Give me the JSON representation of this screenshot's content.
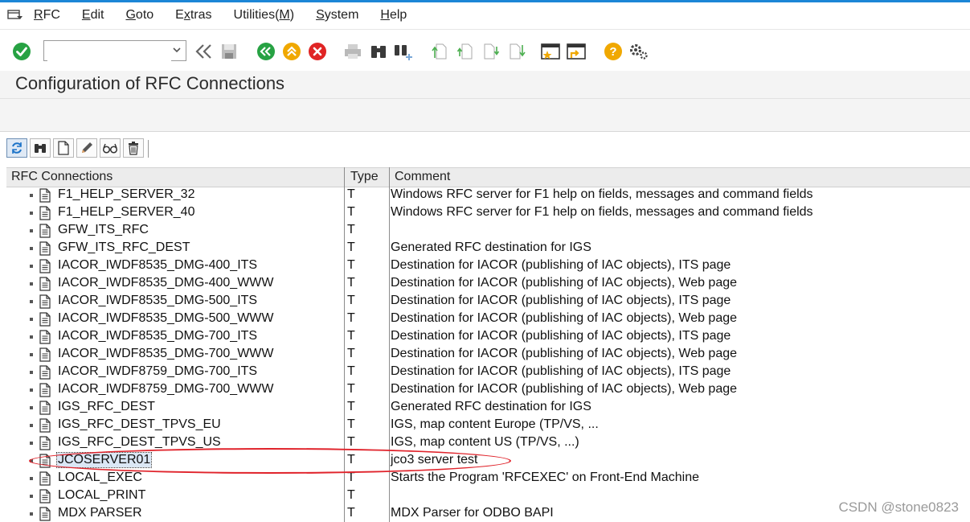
{
  "menu": {
    "items": [
      {
        "label": "RFC",
        "name": "menu-rfc"
      },
      {
        "label": "Edit",
        "name": "menu-edit"
      },
      {
        "label": "Goto",
        "name": "menu-goto"
      },
      {
        "label": "Extras",
        "name": "menu-extras"
      },
      {
        "label": "Utilities(M)",
        "name": "menu-utilities"
      },
      {
        "label": "System",
        "name": "menu-system"
      },
      {
        "label": "Help",
        "name": "menu-help"
      }
    ]
  },
  "toolbar": {
    "command_value": "",
    "icons": [
      "enter-icon",
      "back-double-icon",
      "save-icon",
      "back-icon",
      "exit-icon",
      "cancel-icon",
      "print-icon",
      "find-icon",
      "find-next-icon",
      "first-page-icon",
      "previous-page-icon",
      "next-page-icon",
      "last-page-icon",
      "create-session-icon",
      "shortcut-icon",
      "help-icon",
      "settings-icon"
    ]
  },
  "title": "Configuration of RFC Connections",
  "table": {
    "headers": {
      "name": "RFC Connections",
      "type": "Type",
      "comment": "Comment"
    },
    "rows": [
      {
        "name": "F1_HELP_SERVER_32",
        "type": "T",
        "comment": "Windows RFC server for F1 help on fields, messages and command fields"
      },
      {
        "name": "F1_HELP_SERVER_40",
        "type": "T",
        "comment": "Windows RFC server for F1 help on fields, messages and command fields"
      },
      {
        "name": "GFW_ITS_RFC",
        "type": "T",
        "comment": ""
      },
      {
        "name": "GFW_ITS_RFC_DEST",
        "type": "T",
        "comment": "Generated RFC destination for IGS"
      },
      {
        "name": "IACOR_IWDF8535_DMG-400_ITS",
        "type": "T",
        "comment": "Destination for IACOR (publishing of IAC objects), ITS page"
      },
      {
        "name": "IACOR_IWDF8535_DMG-400_WWW",
        "type": "T",
        "comment": "Destination for IACOR (publishing of IAC objects), Web page"
      },
      {
        "name": "IACOR_IWDF8535_DMG-500_ITS",
        "type": "T",
        "comment": "Destination for IACOR (publishing of IAC objects), ITS page"
      },
      {
        "name": "IACOR_IWDF8535_DMG-500_WWW",
        "type": "T",
        "comment": "Destination for IACOR (publishing of IAC objects), Web page"
      },
      {
        "name": "IACOR_IWDF8535_DMG-700_ITS",
        "type": "T",
        "comment": "Destination for IACOR (publishing of IAC objects), ITS page"
      },
      {
        "name": "IACOR_IWDF8535_DMG-700_WWW",
        "type": "T",
        "comment": "Destination for IACOR (publishing of IAC objects), Web page"
      },
      {
        "name": "IACOR_IWDF8759_DMG-700_ITS",
        "type": "T",
        "comment": "Destination for IACOR (publishing of IAC objects), ITS page"
      },
      {
        "name": "IACOR_IWDF8759_DMG-700_WWW",
        "type": "T",
        "comment": "Destination for IACOR (publishing of IAC objects), Web page"
      },
      {
        "name": "IGS_RFC_DEST",
        "type": "T",
        "comment": "Generated RFC destination for IGS"
      },
      {
        "name": "IGS_RFC_DEST_TPVS_EU",
        "type": "T",
        "comment": "IGS, map content Europe (TP/VS, ..."
      },
      {
        "name": "IGS_RFC_DEST_TPVS_US",
        "type": "T",
        "comment": "IGS, map content US (TP/VS, ...)"
      },
      {
        "name": "JCOSERVER01",
        "type": "T",
        "comment": "jco3 server test",
        "selected": true
      },
      {
        "name": "LOCAL_EXEC",
        "type": "T",
        "comment": "Starts the Program 'RFCEXEC' on Front-End Machine"
      },
      {
        "name": "LOCAL_PRINT",
        "type": "T",
        "comment": ""
      },
      {
        "name": "MDX PARSER",
        "type": "T",
        "comment": "MDX Parser for ODBO BAPI"
      }
    ]
  },
  "watermark": "CSDN @stone0823",
  "colors": {
    "accent": "#1c86d6",
    "highlight": "#e0232b",
    "selection": "#dbe7f5"
  }
}
